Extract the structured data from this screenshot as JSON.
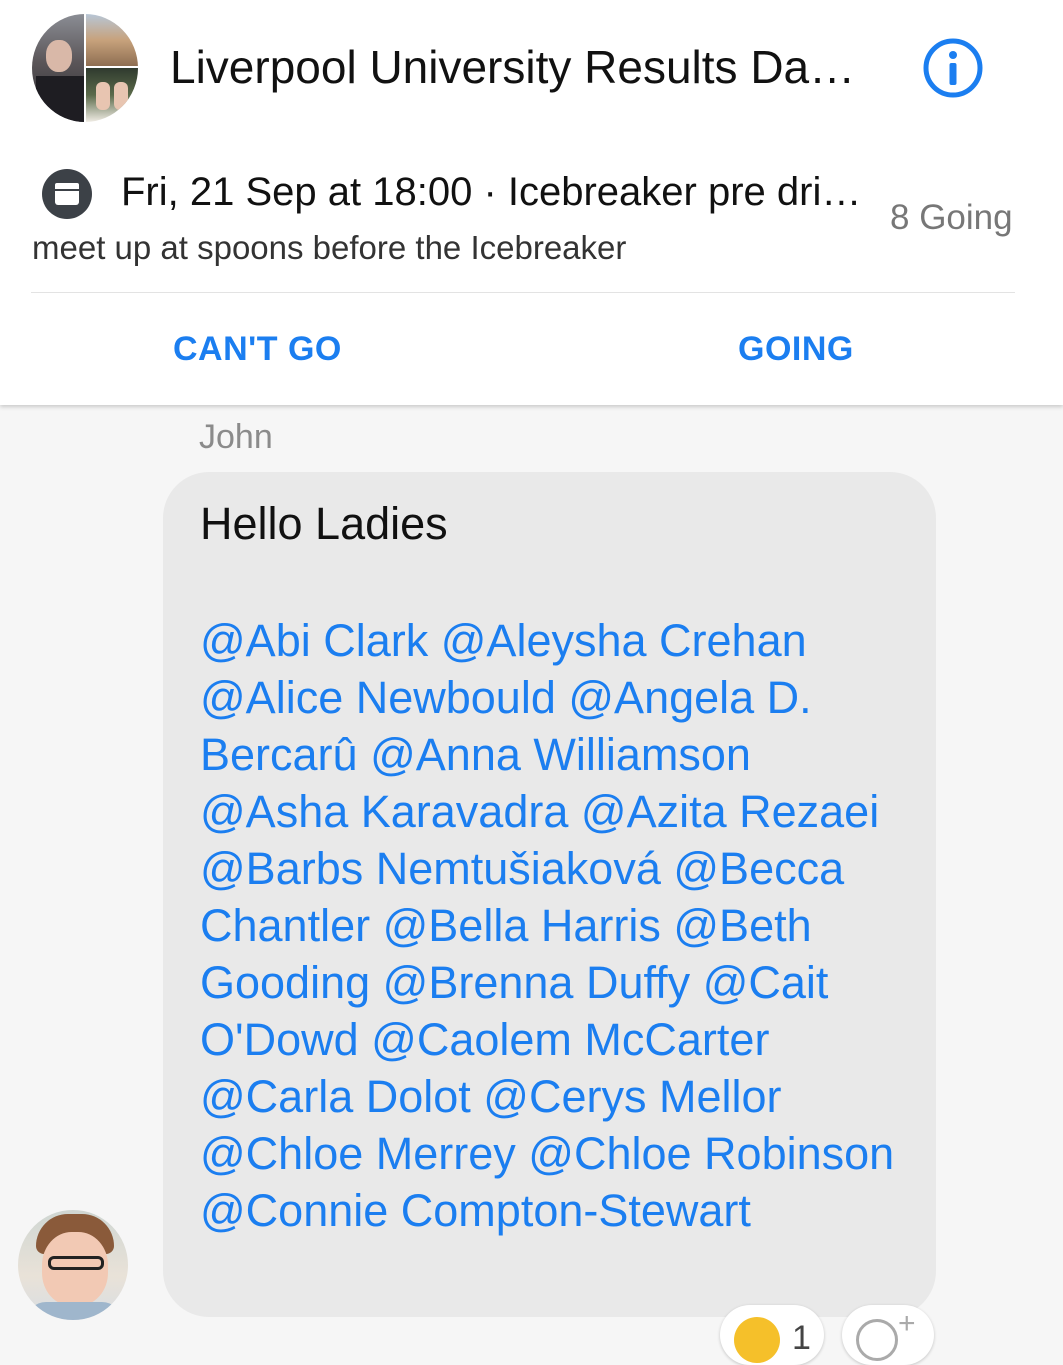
{
  "header": {
    "title": "Liverpool University Results Da…"
  },
  "event": {
    "line": "Fri, 21 Sep at 18:00 · Icebreaker pre dri…",
    "description": "meet up at spoons before the Icebreaker",
    "going_count": "8 Going"
  },
  "rsvp": {
    "cant_go_label": "CAN'T GO",
    "going_label": "GOING"
  },
  "message": {
    "sender": "John",
    "greeting": "Hello Ladies",
    "mentions": [
      "@Abi Clark",
      "@Aleysha Crehan",
      "@Alice Newbould",
      "@Angela D. Bercarû",
      "@Anna Williamson",
      "@Asha Karavadra",
      "@Azita Rezaei",
      "@Barbs Nemtušiaková",
      "@Becca Chantler",
      "@Bella Harris",
      "@Beth Gooding",
      "@Brenna Duffy",
      "@Cait O'Dowd",
      "@Caolem McCarter",
      "@Carla Dolot",
      "@Cerys Mellor",
      "@Chloe Merrey",
      "@Chloe Robinson",
      "@Connie Compton-Stewart"
    ],
    "reaction_count": "1"
  },
  "icons": {
    "info": "info-icon",
    "calendar": "calendar-icon",
    "reaction": "laughing-emoji-icon",
    "add_reaction": "add-reaction-icon"
  },
  "colors": {
    "accent": "#1b7ef0",
    "bubble": "#e9e9e9",
    "background": "#f6f6f6"
  }
}
